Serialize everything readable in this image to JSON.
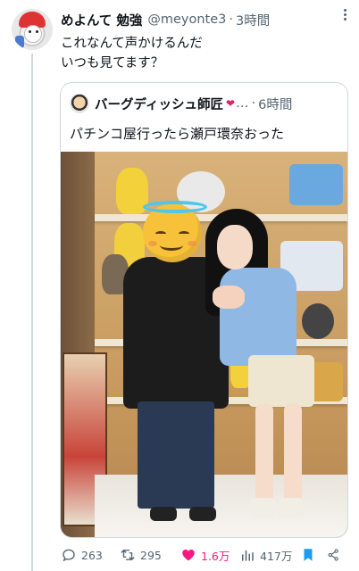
{
  "tweet": {
    "author_name": "めよんて 勉強",
    "handle": "@meyonte3",
    "separator": "·",
    "time": "3時間",
    "text_line1": "これなんて声かけるんだ",
    "text_line2": "いつも見てます？"
  },
  "quote": {
    "author_name": "バーグディッシュ師匠",
    "emoji": "❤",
    "ellipsis": "…",
    "separator": "·",
    "time": "6時間",
    "text": "パチンコ屋行ったら瀬戸環奈おった"
  },
  "actions": {
    "replies": "263",
    "retweets": "295",
    "likes": "1.6万",
    "views": "417万"
  },
  "colors": {
    "like": "#f91880",
    "bookmark": "#1d9bf0",
    "secondary_text": "#536471",
    "border": "#cfd9de"
  },
  "icons": [
    "more-icon",
    "reply-icon",
    "retweet-icon",
    "like-icon",
    "views-icon",
    "bookmark-icon",
    "share-icon"
  ]
}
